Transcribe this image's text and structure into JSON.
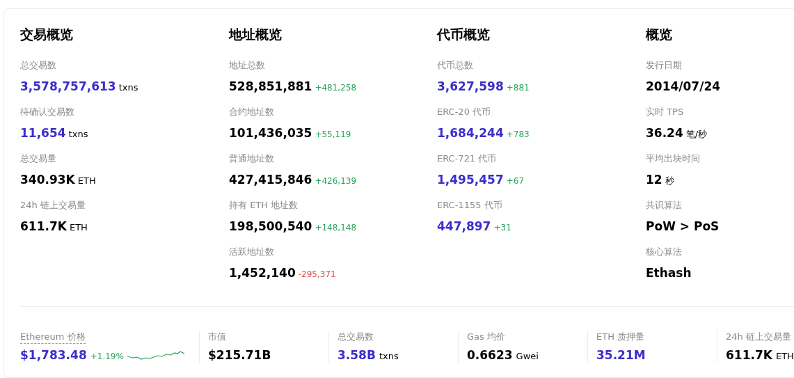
{
  "sections": [
    {
      "title": "交易概览",
      "stats": [
        {
          "label": "总交易数",
          "value": "3,578,757,613",
          "unit": "txns",
          "highlighted": true
        },
        {
          "label": "待确认交易数",
          "value": "11,654",
          "unit": "txns",
          "highlighted": true
        },
        {
          "label": "总交易量",
          "value": "340.93K",
          "unit": "ETH",
          "highlighted": false
        },
        {
          "label": "24h 链上交易量",
          "value": "611.7K",
          "unit": "ETH",
          "highlighted": false
        }
      ]
    },
    {
      "title": "地址概览",
      "stats": [
        {
          "label": "地址总数",
          "value": "528,851,881",
          "change": "+481,258",
          "negative": false,
          "highlighted": false
        },
        {
          "label": "合约地址数",
          "value": "101,436,035",
          "change": "+55,119",
          "negative": false,
          "highlighted": false
        },
        {
          "label": "普通地址数",
          "value": "427,415,846",
          "change": "+426,139",
          "negative": false,
          "highlighted": false
        },
        {
          "label": "持有 ETH 地址数",
          "value": "198,500,540",
          "change": "+148,148",
          "negative": false,
          "highlighted": false
        },
        {
          "label": "活跃地址数",
          "value": "1,452,140",
          "change": "-295,371",
          "negative": true,
          "highlighted": false
        }
      ]
    },
    {
      "title": "代币概览",
      "stats": [
        {
          "label": "代币总数",
          "value": "3,627,598",
          "change": "+881",
          "negative": false,
          "highlighted": true
        },
        {
          "label": "ERC-20 代币",
          "value": "1,684,244",
          "change": "+783",
          "negative": false,
          "highlighted": true
        },
        {
          "label": "ERC-721 代币",
          "value": "1,495,457",
          "change": "+67",
          "negative": false,
          "highlighted": true
        },
        {
          "label": "ERC-1155 代币",
          "value": "447,897",
          "change": "+31",
          "negative": false,
          "highlighted": true
        }
      ]
    },
    {
      "title": "概览",
      "stats": [
        {
          "label": "发行日期",
          "value": "2014/07/24",
          "highlighted": false
        },
        {
          "label": "实时 TPS",
          "value": "36.24",
          "unit": "笔/秒",
          "highlighted": false
        },
        {
          "label": "平均出块时间",
          "value": "12",
          "unit": "秒",
          "highlighted": false
        },
        {
          "label": "共识算法",
          "value": "PoW > PoS",
          "highlighted": false
        },
        {
          "label": "核心算法",
          "value": "Ethash",
          "highlighted": false
        }
      ]
    }
  ],
  "summary": [
    {
      "label": "Ethereum 价格",
      "underlined": true,
      "value": "$1,783.48",
      "change": "+1.19%",
      "negative": false,
      "highlighted": true,
      "sparkline": true
    },
    {
      "label": "市值",
      "underlined": false,
      "value": "$215.71B",
      "highlighted": false
    },
    {
      "label": "总交易数",
      "underlined": false,
      "value": "3.58B",
      "unit": "txns",
      "highlighted": true
    },
    {
      "label": "Gas 均价",
      "underlined": false,
      "value": "0.6623",
      "unit": "Gwei",
      "highlighted": false
    },
    {
      "label": "ETH 质押量",
      "underlined": false,
      "value": "35.21M",
      "highlighted": true
    },
    {
      "label": "24h 链上交易量",
      "underlined": false,
      "value": "611.7K",
      "unit": "ETH",
      "highlighted": false
    }
  ]
}
